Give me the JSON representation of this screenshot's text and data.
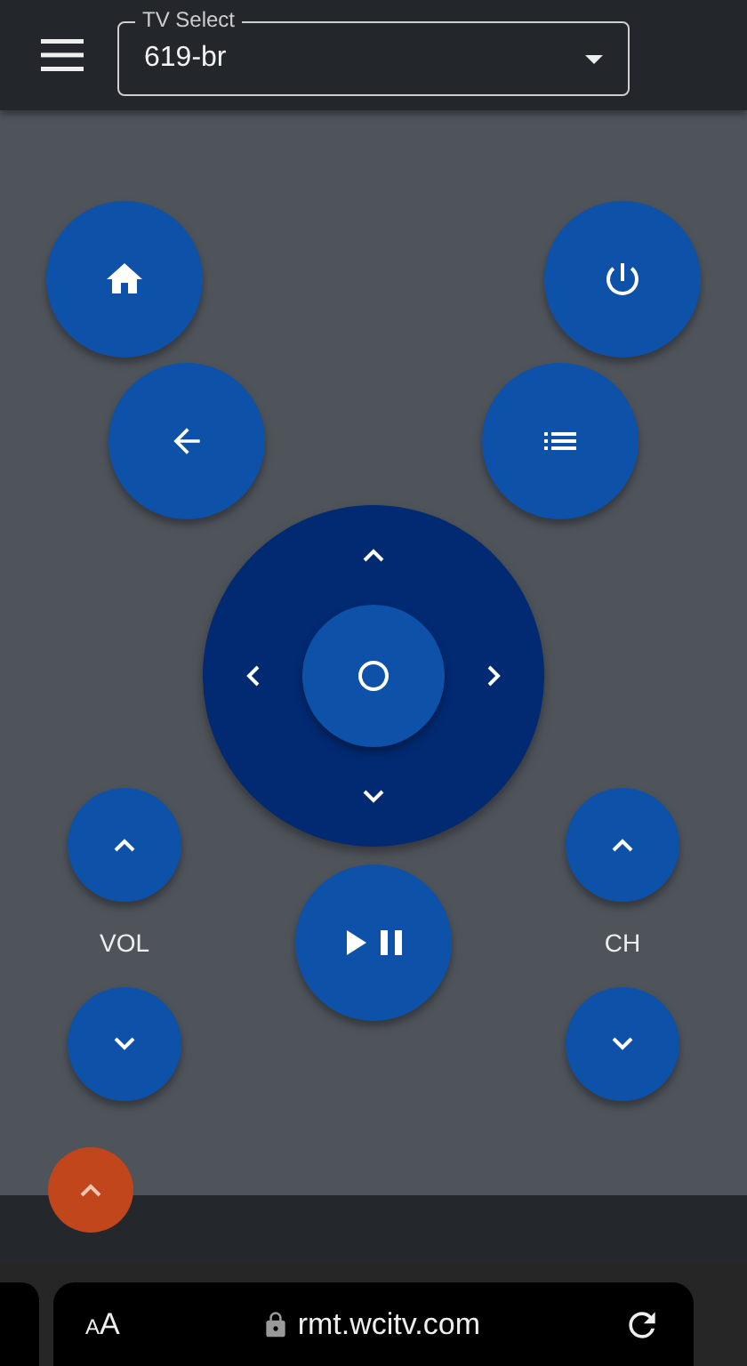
{
  "tv_select": {
    "label": "TV Select",
    "value": "619-br"
  },
  "remote": {
    "volume_label": "VOL",
    "channel_label": "CH"
  },
  "browser_bar": {
    "text_size": "AA",
    "url": "rmt.wcitv.com"
  }
}
